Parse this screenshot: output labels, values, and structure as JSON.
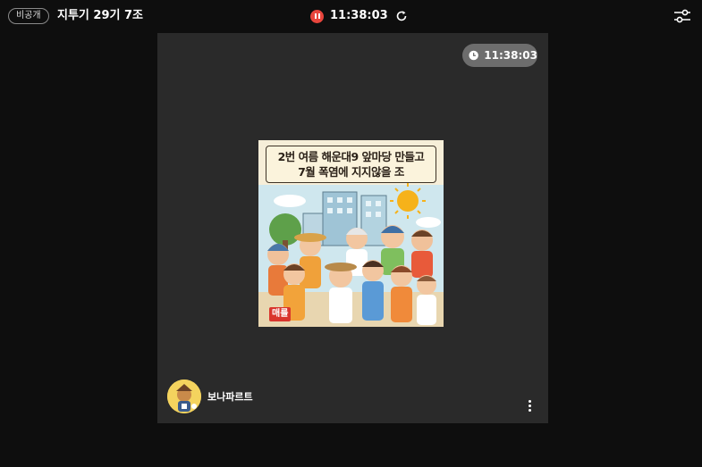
{
  "header": {
    "visibility_badge": "비공개",
    "room_title": "지투기 29기 7조",
    "recording_time": "11:38:03",
    "rec_color": "#e8453c",
    "icons": [
      "pause-icon",
      "refresh-icon",
      "settings-sliders-icon"
    ]
  },
  "stage": {
    "clock_time": "11:38:03",
    "clock_icon": "clock-icon",
    "poster": {
      "line1": "2번 여름 해운대9 앞마당 만들고",
      "line2": "7월 폭염에 지지않을 조",
      "tag": "매를"
    },
    "author": {
      "name": "보나파르트",
      "avatar_icon": "avatar-character"
    },
    "more_icon": "more-vertical-icon"
  }
}
